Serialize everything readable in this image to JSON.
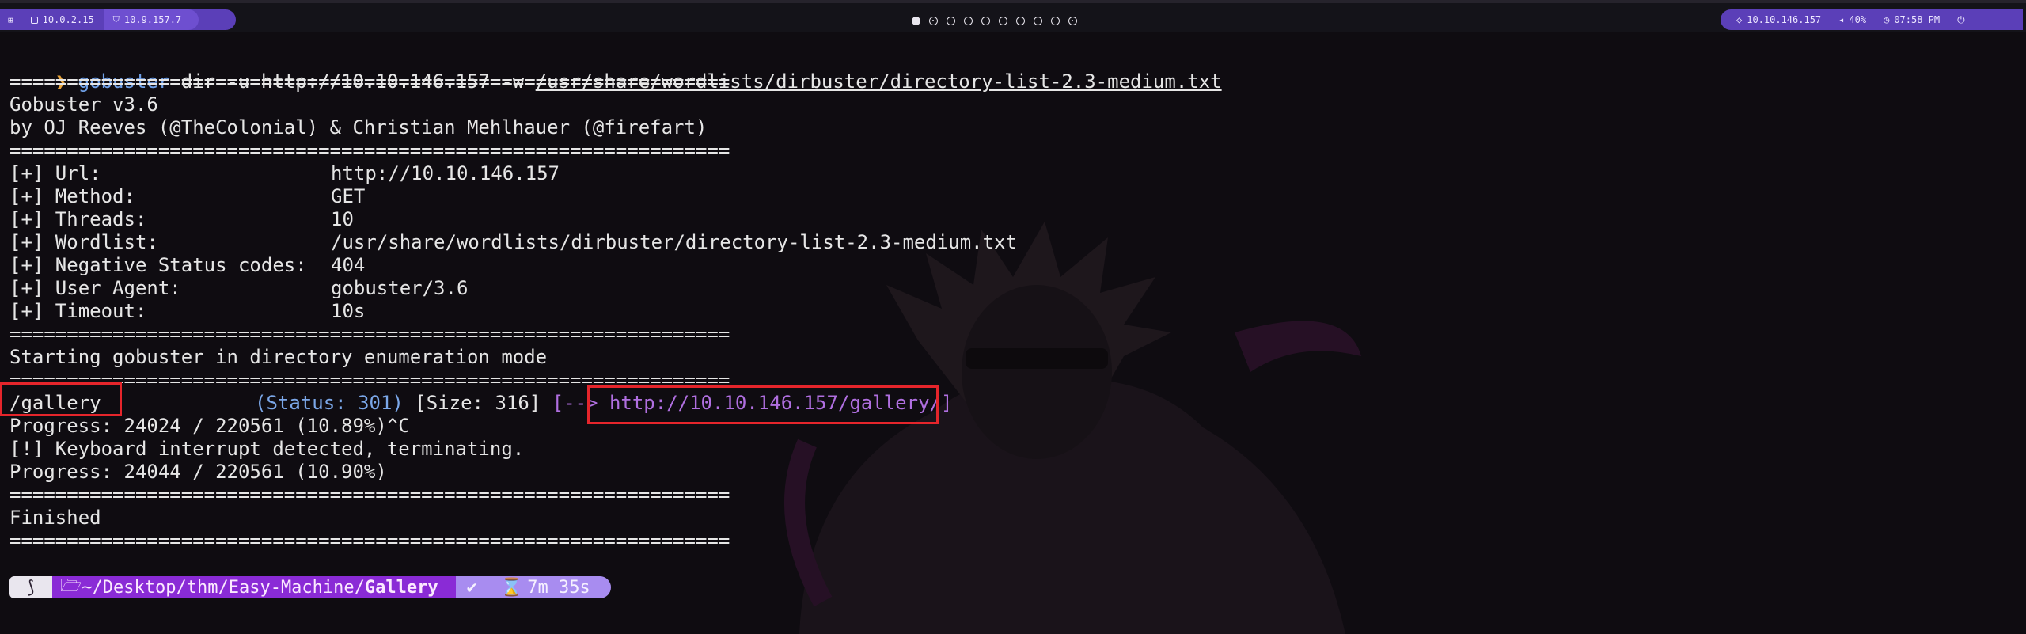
{
  "topbar": {
    "menu_icon": "grid-icon",
    "left_ip1": "10.0.2.15",
    "left_ip2": "10.9.157.7",
    "target_ip": "10.10.146.157",
    "volume": "40%",
    "clock": "07:58 PM",
    "workspaces": [
      "active",
      "dot",
      "empty",
      "empty",
      "empty",
      "empty",
      "empty",
      "empty",
      "empty",
      "dot"
    ]
  },
  "terminal": {
    "prompt_symbol": "❯",
    "cmd_name": "gobuster",
    "cmd_args": " dir -u http://10.10.146.157 -w ",
    "cmd_wordlist": "/usr/share/wordlists/dirbuster/directory-list-2.3-medium.txt",
    "separator": "===============================================================",
    "banner_version": "Gobuster v3.6",
    "banner_authors": "by OJ Reeves (@TheColonial) & Christian Mehlhauer (@firefart)",
    "config": [
      {
        "label": "[+] Url:",
        "value": "http://10.10.146.157"
      },
      {
        "label": "[+] Method:",
        "value": "GET"
      },
      {
        "label": "[+] Threads:",
        "value": "10"
      },
      {
        "label": "[+] Wordlist:",
        "value": "/usr/share/wordlists/dirbuster/directory-list-2.3-medium.txt"
      },
      {
        "label": "[+] Negative Status codes:",
        "value": "404"
      },
      {
        "label": "[+] User Agent:",
        "value": "gobuster/3.6"
      },
      {
        "label": "[+] Timeout:",
        "value": "10s"
      }
    ],
    "start_msg": "Starting gobuster in directory enumeration mode",
    "result": {
      "path": "/gallery",
      "status": "(Status: 301)",
      "size": "[Size: 316]",
      "arrow": "[-->",
      "url": "http://10.10.146.157/gallery/",
      "close": "]"
    },
    "progress1": "Progress: 24024 / 220561 (10.89%)^C",
    "interrupt": "[!] Keyboard interrupt detected, terminating.",
    "progress2": "Progress: 24044 / 220561 (10.90%)",
    "finished": "Finished"
  },
  "prompt": {
    "os_icon": "kali-dragon-icon",
    "folder_icon": "folder-open-icon",
    "dir_prefix": "~/Desktop/thm/Easy-Machine/",
    "dir_current": "Gallery",
    "status_icon": "check-icon",
    "status_text": "✔",
    "timer_icon": "hourglass-icon",
    "elapsed": "7m 35s"
  },
  "colors": {
    "accent_purple": "#5b3fb8",
    "highlight_red": "#e5252b",
    "prompt_orange": "#e8a53c",
    "status_blue": "#7ba7e8",
    "link_purple": "#b06fe0"
  }
}
